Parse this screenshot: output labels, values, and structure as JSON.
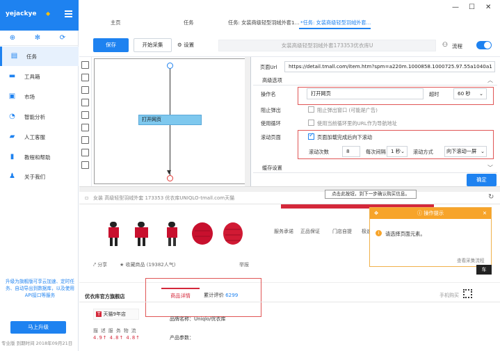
{
  "sidebar": {
    "username": "yejackye",
    "nav": [
      {
        "label": "任务",
        "icon": "task-icon"
      },
      {
        "label": "工具箱",
        "icon": "toolbox-icon"
      },
      {
        "label": "市场",
        "icon": "market-icon"
      },
      {
        "label": "智能分析",
        "icon": "pie-chart-icon"
      },
      {
        "label": "人工客服",
        "icon": "chat-icon"
      },
      {
        "label": "教程和帮助",
        "icon": "book-icon"
      },
      {
        "label": "关于我们",
        "icon": "user-icon"
      }
    ],
    "promo": "升级为旗舰版可享云加速、定时任务、自动导出到数据库，以及使用API接口等服务",
    "upgrade": "马上升级",
    "footer": "专业版  到期时间 2018年09月21日"
  },
  "tabs": [
    "主页",
    "任务",
    "任务: 女装商级轻型羽绒外套1...",
    "*任务: 女装商级轻型羽绒外套..."
  ],
  "toolbar": {
    "save": "保存",
    "start": "开始采集",
    "settings": "设置",
    "url_title": "女装高级轻型羽绒外套173353优衣库U",
    "flow": "流程"
  },
  "flow": {
    "node_label": "打开网页"
  },
  "props": {
    "url_label": "页面Url",
    "url_value": "https://detail.tmall.com/item.htm?spm=a220m.1000858.1000725.97.55a1040a1",
    "advanced": "高级选项",
    "op_label": "操作名",
    "op_value": "打开网页",
    "timeout_label": "超时",
    "timeout_value": "60 秒",
    "block_label": "阻止弹出",
    "block_text": "阻止弹出窗口 (可能是广告)",
    "loop_label": "使用循环",
    "loop_text": "使用当前循环里的URL作为导航地址",
    "scroll_label": "滚动页面",
    "scroll_text": "页面加载完成后向下滚动",
    "scroll_count_label": "滚动次数",
    "scroll_count": "8",
    "interval_label": "每次间隔",
    "interval_value": "1 秒",
    "mode_label": "滚动方式",
    "mode_value": "向下滚动一屏",
    "cache": "缓存设置",
    "ok": "确定"
  },
  "browser": {
    "address": "女装 高级轻型羽绒外套 173353 优衣库UNIQLO-tmall.com天猫",
    "tooltip": "点击此按钮，到下一步确认购买信息。",
    "services": [
      "服务承诺",
      "正品保证",
      "门店自提",
      "极速退款"
    ],
    "share": "分享",
    "fav": "收藏商品 (19382人气)",
    "report": "举报",
    "shop_name": "优衣库官方旗舰店",
    "shop_badge": "天猫9年店",
    "ratings_labels": "描 述  服 务  物 流",
    "ratings_values": "4.9↑ 4.8↑ 4.8↑",
    "tab_detail": "商品详情",
    "tab_review": "累计评价",
    "review_count": "6299",
    "brand": "品牌名称：Uniqlo/优衣库",
    "params": "产品参数：",
    "mobile": "手机购买",
    "car": "车"
  },
  "popup": {
    "title": "操作提示",
    "message": "请选择页面元素。",
    "link": "查看采集流程"
  }
}
